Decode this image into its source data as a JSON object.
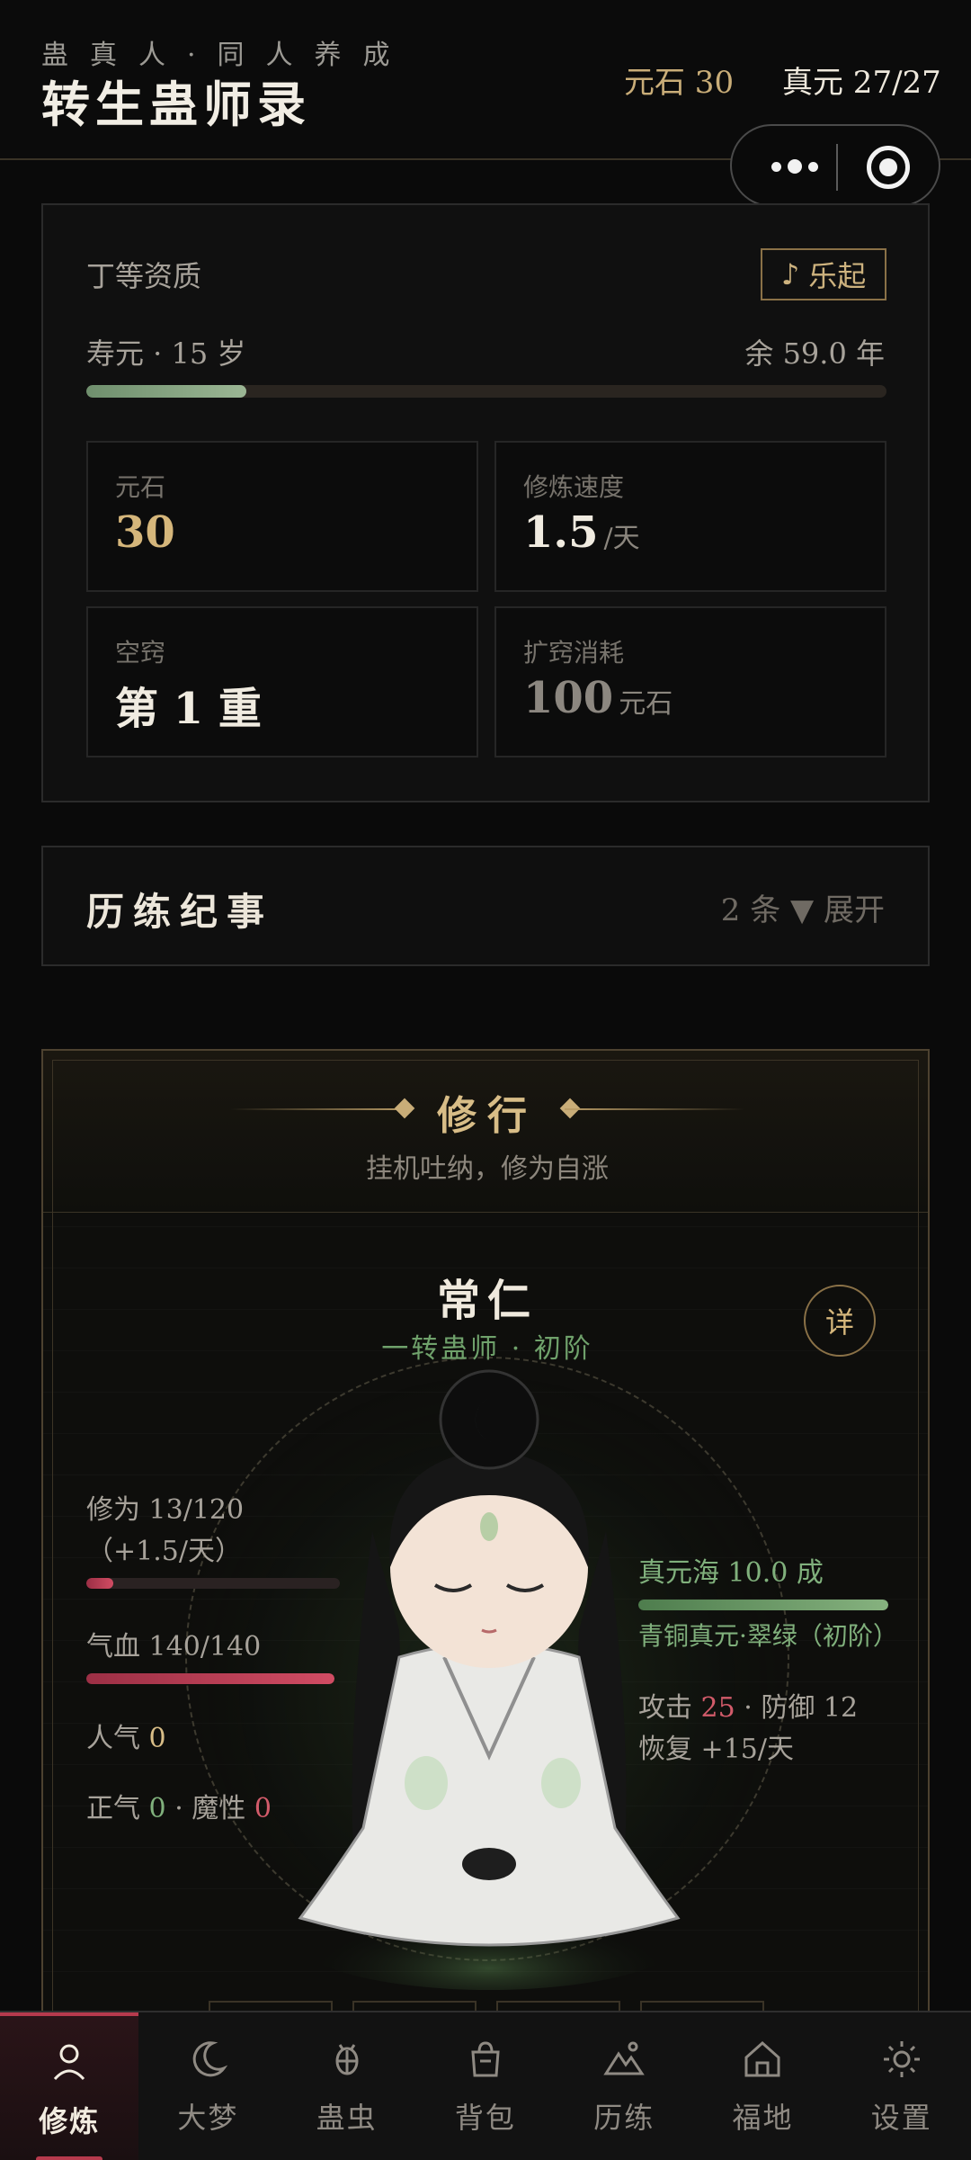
{
  "header": {
    "subtitle": "蛊真人·同人养成",
    "title": "转生蛊师录",
    "stone_label": "元石 30",
    "zhenyuan_label": "真元 27/27"
  },
  "status": {
    "aptitude": "丁等资质",
    "music_button": "乐起",
    "lifespan_label": "寿元 · 15 岁",
    "lifespan_remaining": "余 59.0 年",
    "lifespan_progress": 0.2,
    "stats": [
      {
        "label": "元石",
        "value": "30",
        "unit": ""
      },
      {
        "label": "修炼速度",
        "value": "1.5",
        "unit": "/天"
      },
      {
        "label": "空窍",
        "value": "第 1 重",
        "unit": ""
      },
      {
        "label": "扩窍消耗",
        "value": "100",
        "unit": "元石"
      }
    ]
  },
  "chronicle": {
    "title": "历练纪事",
    "count_toggle": "2 条 ▼ 展开"
  },
  "cultivation": {
    "title": "修行",
    "description": "挂机吐纳，修为自涨",
    "character_name": "常仁",
    "character_rank": "一转蛊师 · 初阶",
    "detail_button": "详",
    "cultivation_text": "修为 13/120（+1.5/天）",
    "cultivation_progress": 0.108,
    "hp_text": "气血 140/140",
    "hp_progress": 1.0,
    "popularity_label": "人气",
    "popularity_value": "0",
    "righteous_label": "正气",
    "righteous_value": "0",
    "demonic_label": "魔性",
    "demonic_value": "0",
    "aperture_text": "真元海 10.0 成",
    "aperture_progress": 1.0,
    "essence_type": "青铜真元·翠绿（初阶）",
    "attack_label": "攻击",
    "attack_value": "25",
    "defense_text": "防御 12",
    "recovery_text": "恢复 +15/天"
  },
  "nav": {
    "items": [
      {
        "label": "修炼",
        "icon": "person-icon",
        "active": true
      },
      {
        "label": "大梦",
        "icon": "moon-icon",
        "active": false
      },
      {
        "label": "蛊虫",
        "icon": "bug-icon",
        "active": false
      },
      {
        "label": "背包",
        "icon": "bag-icon",
        "active": false
      },
      {
        "label": "历练",
        "icon": "mountain-icon",
        "active": false
      },
      {
        "label": "福地",
        "icon": "home-icon",
        "active": false
      },
      {
        "label": "设置",
        "icon": "sun-icon",
        "active": false
      }
    ]
  },
  "colors": {
    "accent_gold": "#c9ad78",
    "accent_red": "#b63a4d",
    "accent_green": "#6fa16b",
    "background": "#0a0a0a"
  }
}
